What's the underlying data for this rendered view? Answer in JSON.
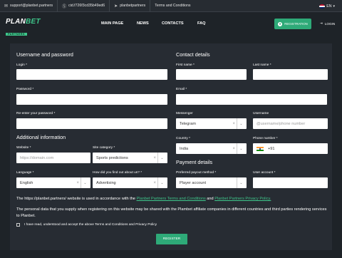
{
  "topbar": {
    "email": "support@planbet.partners",
    "skype": "cid.f726f3cd35b49ed6",
    "telegram": "planbetpartners",
    "terms": "Terms and Conditions",
    "lang": "EN",
    "icons": {
      "email": "mail-icon",
      "skype": "skype-icon",
      "telegram": "telegram-icon"
    }
  },
  "header": {
    "logo_text_a": "PLAN",
    "logo_text_b": "BET",
    "logo_sub": "PARTNERS",
    "nav": [
      "MAIN PAGE",
      "NEWS",
      "CONTACTS",
      "FAQ"
    ],
    "register_label": "REGISTRATION",
    "login_label": "LOGIN"
  },
  "form": {
    "sections": {
      "credentials": "Username and password",
      "contact": "Contact details",
      "additional": "Additional information",
      "payment": "Payment details"
    },
    "labels": {
      "login": "Login *",
      "password": "Password *",
      "repassword": "Re-enter your password *",
      "first_name": "First name *",
      "last_name": "Last name *",
      "email": "Email *",
      "messenger": "Messenger",
      "username": "Username",
      "country": "Country *",
      "phone": "Phone number *",
      "website": "Website *",
      "site_category": "Site category *",
      "language": "Language *",
      "how_found": "How did you find out about us? *",
      "payout": "Preferred payout method *",
      "user_account": "User account *"
    },
    "values": {
      "messenger": "Telegram",
      "username_placeholder": "@username/phone number",
      "country": "India",
      "phone": "+91",
      "website_placeholder": "https://domain.com",
      "site_category": "Sports predictions",
      "language": "English",
      "how_found": "Advertising",
      "payout": "Player account"
    },
    "notice_a": "The https://planbet.partners/ website is used in accordance with the ",
    "notice_link1": "Planbet Partners Terms and Conditions",
    "notice_and": " and ",
    "notice_link2": "Planbet Partners Privacy Policy.",
    "notice_b": "The personal data that you supply when registering on this website may be shared with the Plambet affiliate companies in different countries and third parties rendering services to Planbet.",
    "consent": "I have read, understood and accept the above Terms and Conditions and Privacy Policy",
    "submit": "REGISTER"
  },
  "colors": {
    "accent": "#2eaa78",
    "bg": "#1e2328",
    "panel": "#272c33"
  }
}
